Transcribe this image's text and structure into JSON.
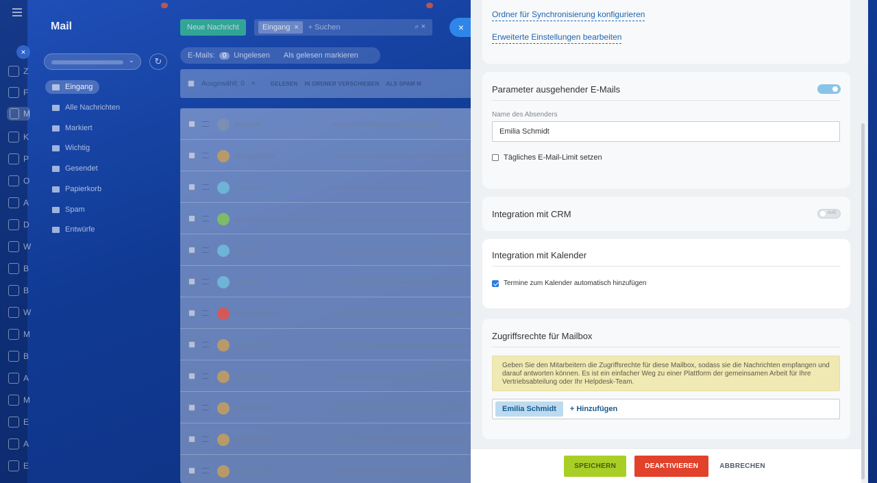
{
  "sidebar": {
    "title": "Mail",
    "folders": [
      {
        "label": "Eingang",
        "icon": "inbox-icon",
        "active": true
      },
      {
        "label": "Alle Nachrichten",
        "icon": "folder-icon"
      },
      {
        "label": "Markiert",
        "icon": "folder-icon"
      },
      {
        "label": "Wichtig",
        "icon": "folder-icon"
      },
      {
        "label": "Gesendet",
        "icon": "sent-icon"
      },
      {
        "label": "Papierkorb",
        "icon": "trash-icon"
      },
      {
        "label": "Spam",
        "icon": "spam-icon"
      },
      {
        "label": "Entwürfe",
        "icon": "drafts-icon"
      }
    ]
  },
  "toolbar": {
    "new_message": "Neue Nachricht",
    "filter_tag": "Eingang",
    "search_placeholder": "+ Suchen",
    "emails_label": "E-Mails:",
    "unread_count": "0",
    "unread_label": "Ungelesen",
    "mark_read": "Als gelesen markieren",
    "selected_label": "Ausgewählt: 0",
    "act_read": "GELESEN",
    "act_move": "IN ORDNER VERSCHIEBEN",
    "act_spam": "ALS SPAM M"
  },
  "rail": {
    "letters": [
      "Z",
      "F",
      "M",
      "K",
      "P",
      "O",
      "A",
      "D",
      "W",
      "B",
      "B",
      "W",
      "M",
      "B",
      "A",
      "M",
      "E",
      "A",
      "E"
    ]
  },
  "panel": {
    "links": {
      "sync_folders": "Ordner für Synchronisierung konfigurieren",
      "advanced": "Erweiterte Einstellungen bearbeiten"
    },
    "outgoing": {
      "title": "Parameter ausgehender E-Mails",
      "sender_label": "Name des Absenders",
      "sender_value": "Emilia Schmidt",
      "daily_limit": "Tägliches E-Mail-Limit setzen"
    },
    "crm": {
      "title": "Integration mit CRM",
      "toggle_text": "AUS"
    },
    "calendar": {
      "title": "Integration mit Kalender",
      "option": "Termine zum Kalender automatisch hinzufügen"
    },
    "access": {
      "title": "Zugriffsrechte für Mailbox",
      "info": "Geben Sie den Mitarbeitern die Zugriffsrechte für diese Mailbox, sodass sie die Nachrichten empfangen und darauf antworten können. Es ist ein einfacher Weg zu einer Plattform der gemeinsamen Arbeit für Ihre Vertriebsabteilung oder Ihr Helpdesk-Team.",
      "person": "Emilia Schmidt",
      "add": "+ Hinzufügen"
    },
    "footer": {
      "save": "SPEICHERN",
      "deactivate": "DEAKTIVIEREN",
      "cancel": "ABBRECHEN"
    }
  },
  "colors": {
    "save": "#a9cf27",
    "deactivate": "#e2412b",
    "link": "#2066b0",
    "accent": "#2c7be5"
  }
}
